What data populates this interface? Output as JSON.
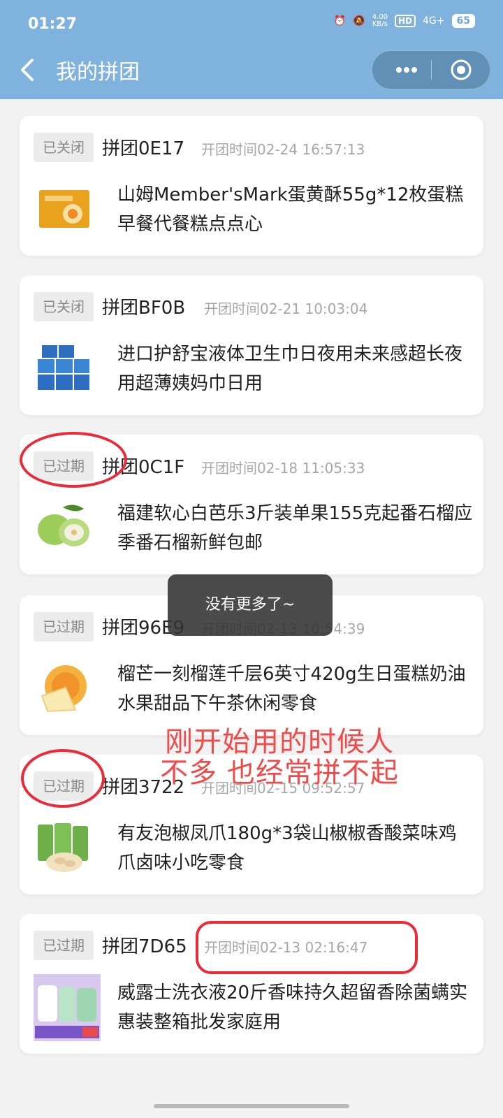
{
  "status_bar": {
    "time": "01:27",
    "net_speed": "4.00",
    "net_unit": "KB/s",
    "hd": "HD",
    "net_type": "4G+",
    "battery": "65"
  },
  "header": {
    "title": "我的拼团",
    "icons": [
      "back-icon",
      "more-icon",
      "close-target-icon"
    ]
  },
  "cards": [
    {
      "status": "已关闭",
      "group": "拼团0E17",
      "time": "开团时间02-24 16:57:13",
      "title": "山姆Member'sMark蛋黄酥55g*12枚蛋糕早餐代餐糕点点心"
    },
    {
      "status": "已关闭",
      "group": "拼团BF0B",
      "time": "开团时间02-21 10:03:04",
      "title": "进口护舒宝液体卫生巾日夜用未来感超长夜用超薄姨妈巾日用"
    },
    {
      "status": "已过期",
      "group": "拼团0C1F",
      "time": "开团时间02-18 11:05:33",
      "title": "福建软心白芭乐3斤装单果155克起番石榴应季番石榴新鲜包邮"
    },
    {
      "status": "已过期",
      "group": "拼团96E9",
      "time": "开团时间02-13 10:54:39",
      "title": "榴芒一刻榴莲千层6英寸420g生日蛋糕奶油水果甜品下午茶休闲零食"
    },
    {
      "status": "已过期",
      "group": "拼团3722",
      "time": "开团时间02-15 09:52:57",
      "title": "有友泡椒凤爪180g*3袋山椒椒香酸菜味鸡爪卤味小吃零食"
    },
    {
      "status": "已过期",
      "group": "拼团7D65",
      "time": "开团时间02-13 02:16:47",
      "title": "威露士洗衣液20斤香味持久超留香除菌螨实惠装整箱批发家庭用"
    }
  ],
  "toast": "没有更多了~",
  "annotation": {
    "line1": "刚开始用的时候人",
    "line2": "不多 也经常拼不起"
  },
  "colors": {
    "header_bg": "#7fb3dd",
    "annotation_red": "#ea2c3a"
  }
}
